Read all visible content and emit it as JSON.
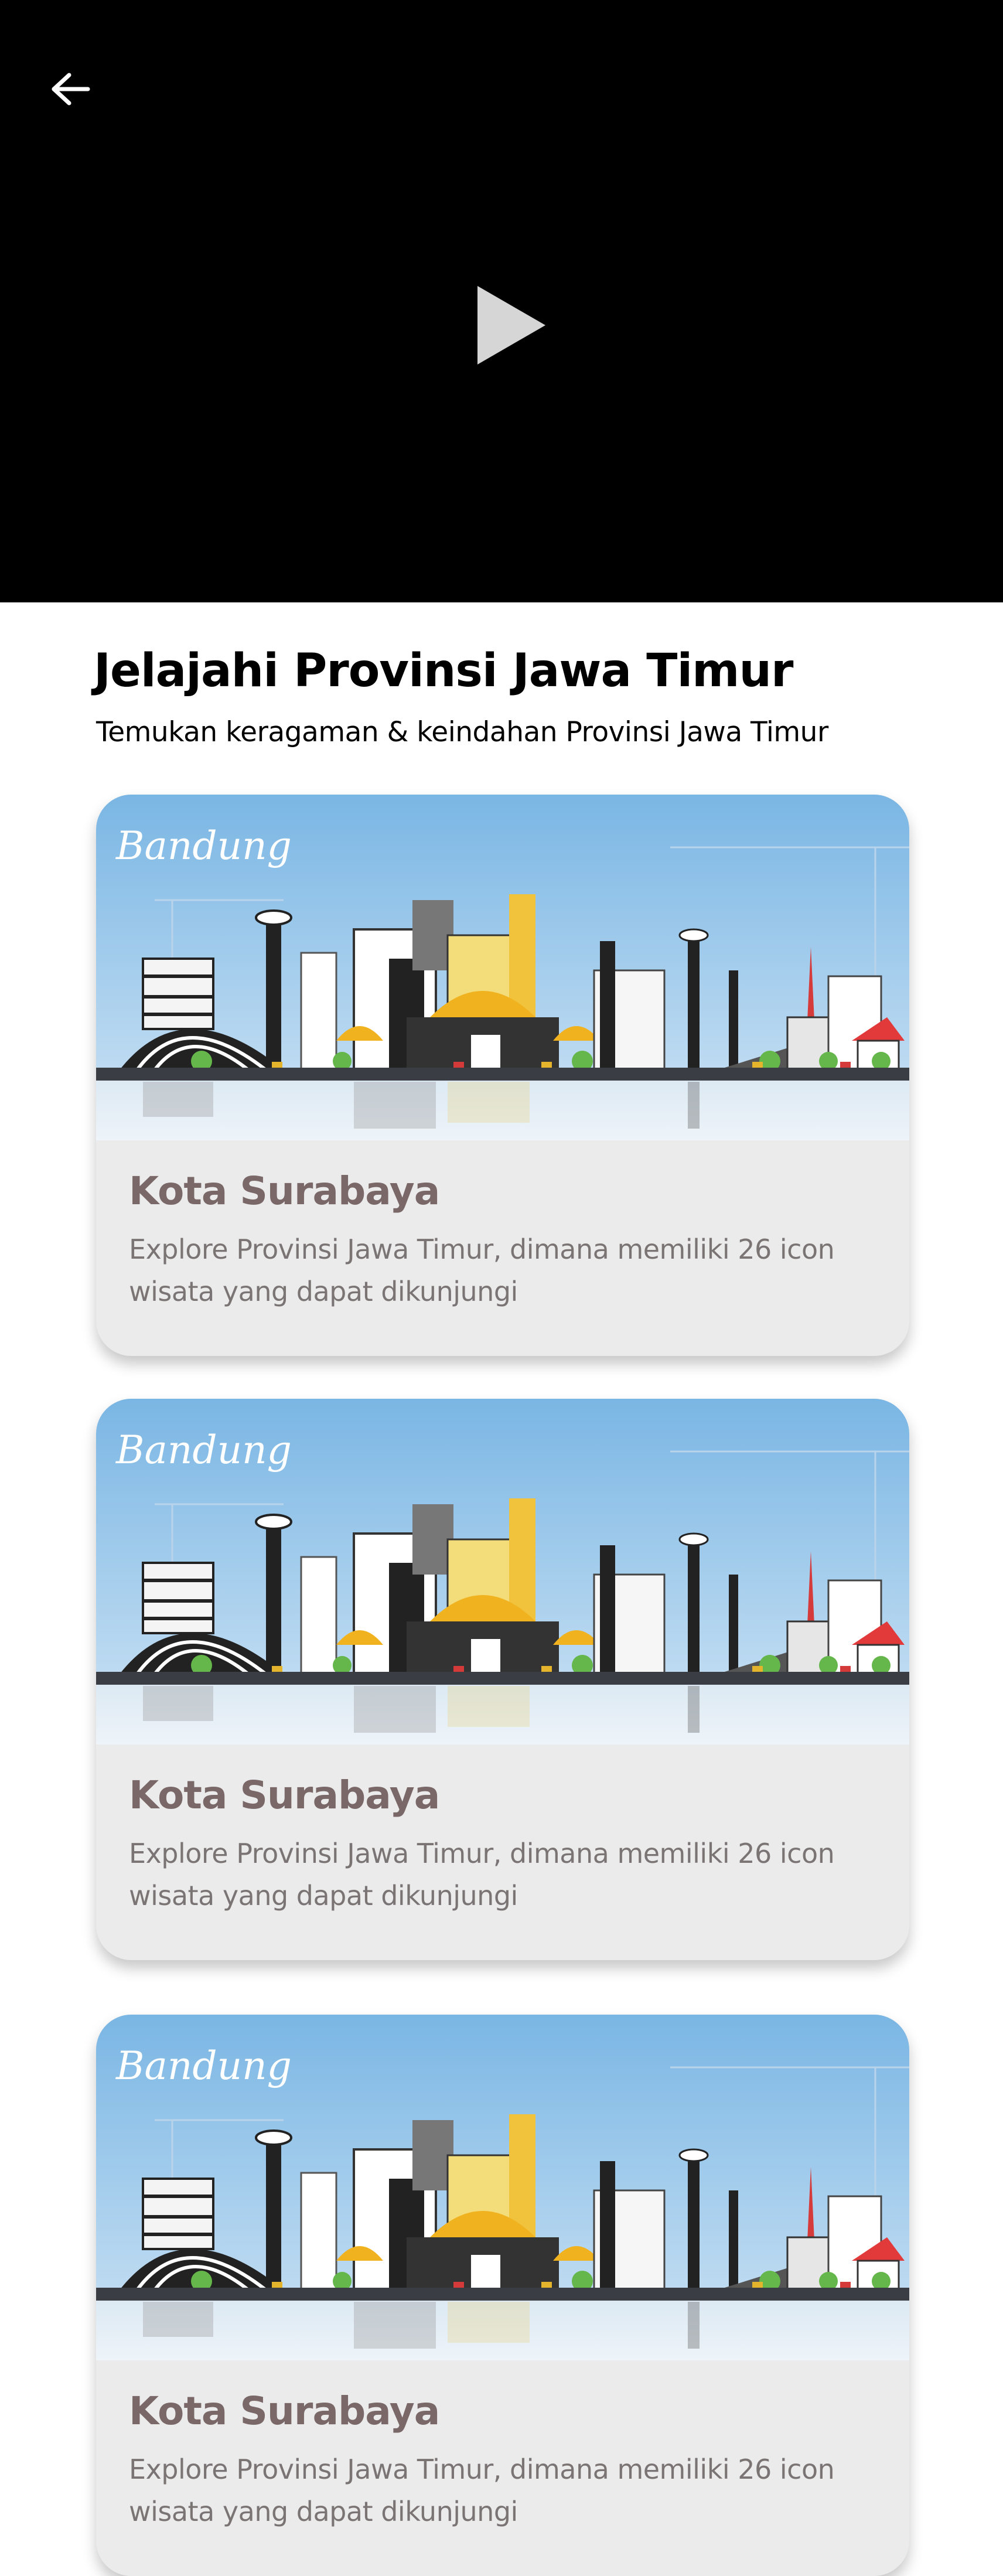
{
  "colors": {
    "video_background": "#000000",
    "card_background": "#ebebec",
    "card_title": "#7a6868",
    "card_text": "#7b7474",
    "sky": "#8ec4ea"
  },
  "video": {
    "back_icon": "arrow-left-icon",
    "play_icon": "play-icon"
  },
  "page": {
    "title": "Jelajahi Provinsi Jawa Timur",
    "subtitle": "Temukan keragaman & keindahan Provinsi Jawa Timur"
  },
  "cards": [
    {
      "banner_text": "Bandung",
      "title": "Kota Surabaya",
      "description": "Explore Provinsi Jawa Timur, dimana memiliki 26 icon wisata yang dapat dikunjungi"
    },
    {
      "banner_text": "Bandung",
      "title": "Kota Surabaya",
      "description": "Explore Provinsi Jawa Timur, dimana memiliki 26 icon wisata yang dapat dikunjungi"
    },
    {
      "banner_text": "Bandung",
      "title": "Kota Surabaya",
      "description": "Explore Provinsi Jawa Timur, dimana memiliki 26 icon wisata yang dapat dikunjungi"
    }
  ]
}
